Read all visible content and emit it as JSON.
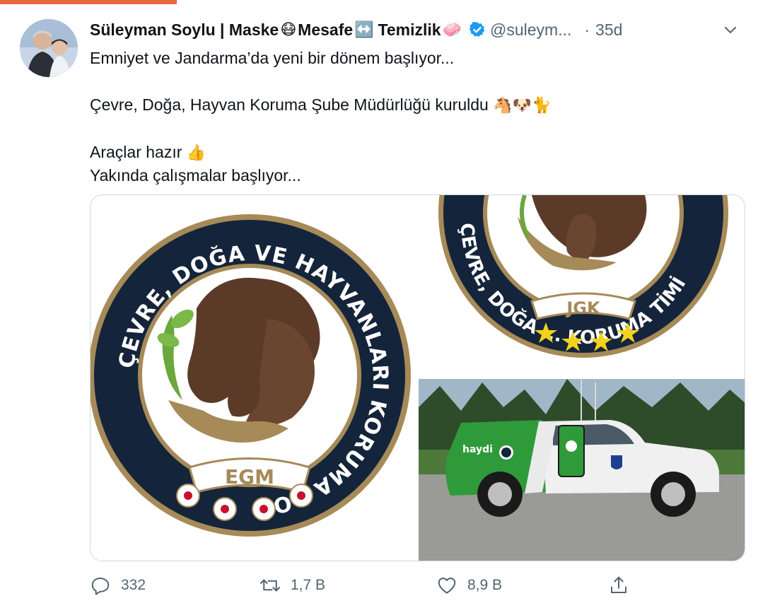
{
  "tweet": {
    "display_name": "Süleyman Soylu | Maske",
    "name_emoji_1": "😷",
    "name_part_2": "Mesafe",
    "name_emoji_2": "↔️",
    "name_part_3": "Temizlik",
    "name_emoji_3": "🧼",
    "handle": "@suleym...",
    "separator": "·",
    "time": "35d",
    "lines": {
      "l1": "Emniyet ve Jandarma’da yeni bir dönem başlıyor...",
      "l2": "Çevre, Doğa, Hayvan Koruma Şube Müdürlüğü kuruldu",
      "l2_emoji": "🐴🐶🐈",
      "l3": "Araçlar hazır",
      "l3_emoji": "👍",
      "l4": "Yakında çalışmalar başlıyor..."
    }
  },
  "media": {
    "left_logo": {
      "ring_text": "ÇEVRE, DOĞA VE HAYVANLARI KORUMA POLİSİ",
      "badge": "EGM"
    },
    "right_logo": {
      "ring_text": "ÇEVRE, DOĞA ... KORUMA TİMİ",
      "badge": "JGK"
    },
    "vehicle_brand": "haydi"
  },
  "actions": {
    "reply_count": "332",
    "retweet_count": "1,7 B",
    "like_count": "8,9 B"
  },
  "colors": {
    "accent": "#e8693f",
    "verified": "#1d9bf0",
    "ring_navy": "#14243a",
    "ring_gold": "#a68a58",
    "brown": "#5b3b28",
    "vehicle_green": "#2f9a3a"
  }
}
